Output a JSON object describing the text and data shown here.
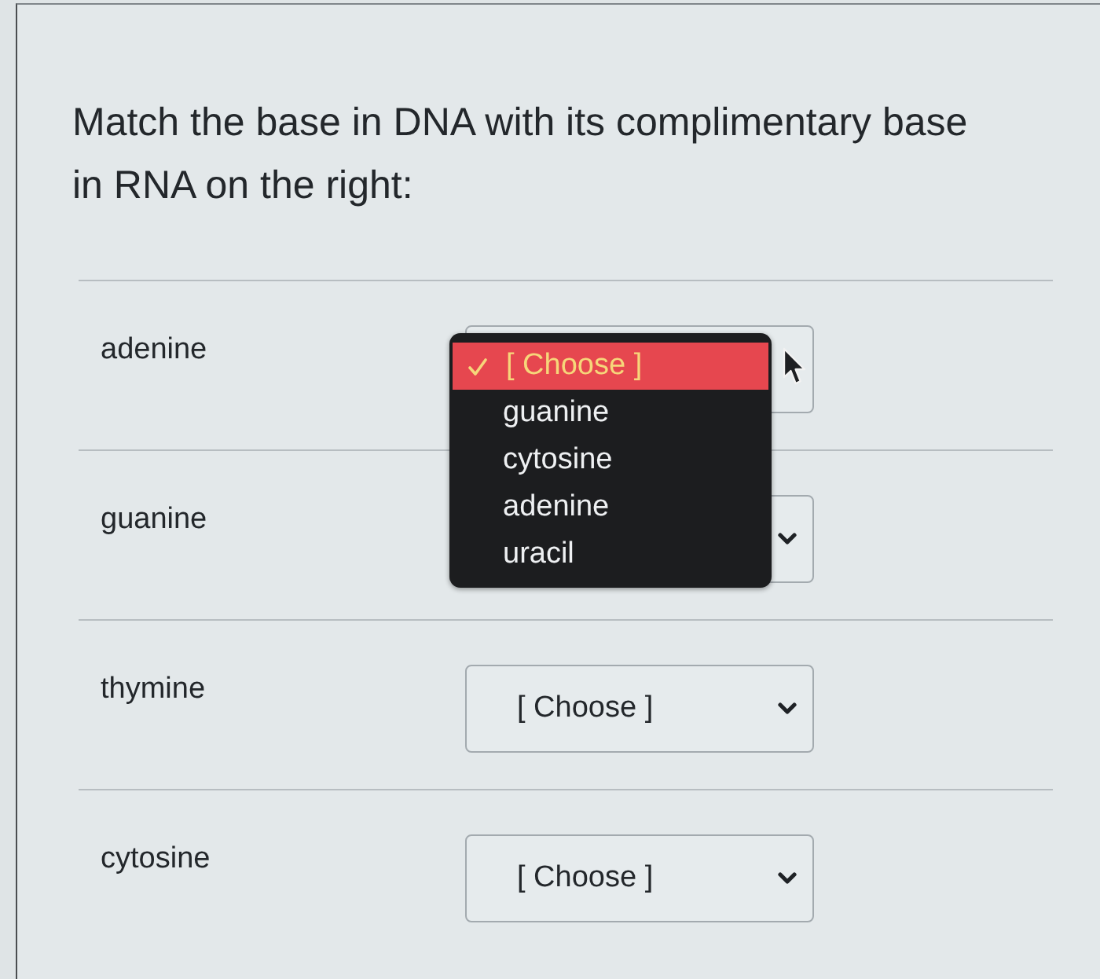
{
  "question": {
    "text": "Match the base in DNA with its complimentary base in RNA on the right:"
  },
  "rows": [
    {
      "term": "adenine",
      "select": {
        "expanded": true,
        "options": [
          {
            "label": "[ Choose ]",
            "selected": true
          },
          {
            "label": "guanine",
            "selected": false
          },
          {
            "label": "cytosine",
            "selected": false
          },
          {
            "label": "adenine",
            "selected": false
          },
          {
            "label": "uracil",
            "selected": false
          }
        ]
      }
    },
    {
      "term": "guanine",
      "select": {
        "expanded": false
      }
    },
    {
      "term": "thymine",
      "select": {
        "expanded": false,
        "value": "[ Choose ]"
      }
    },
    {
      "term": "cytosine",
      "select": {
        "expanded": false,
        "value": "[ Choose ]"
      }
    }
  ]
}
